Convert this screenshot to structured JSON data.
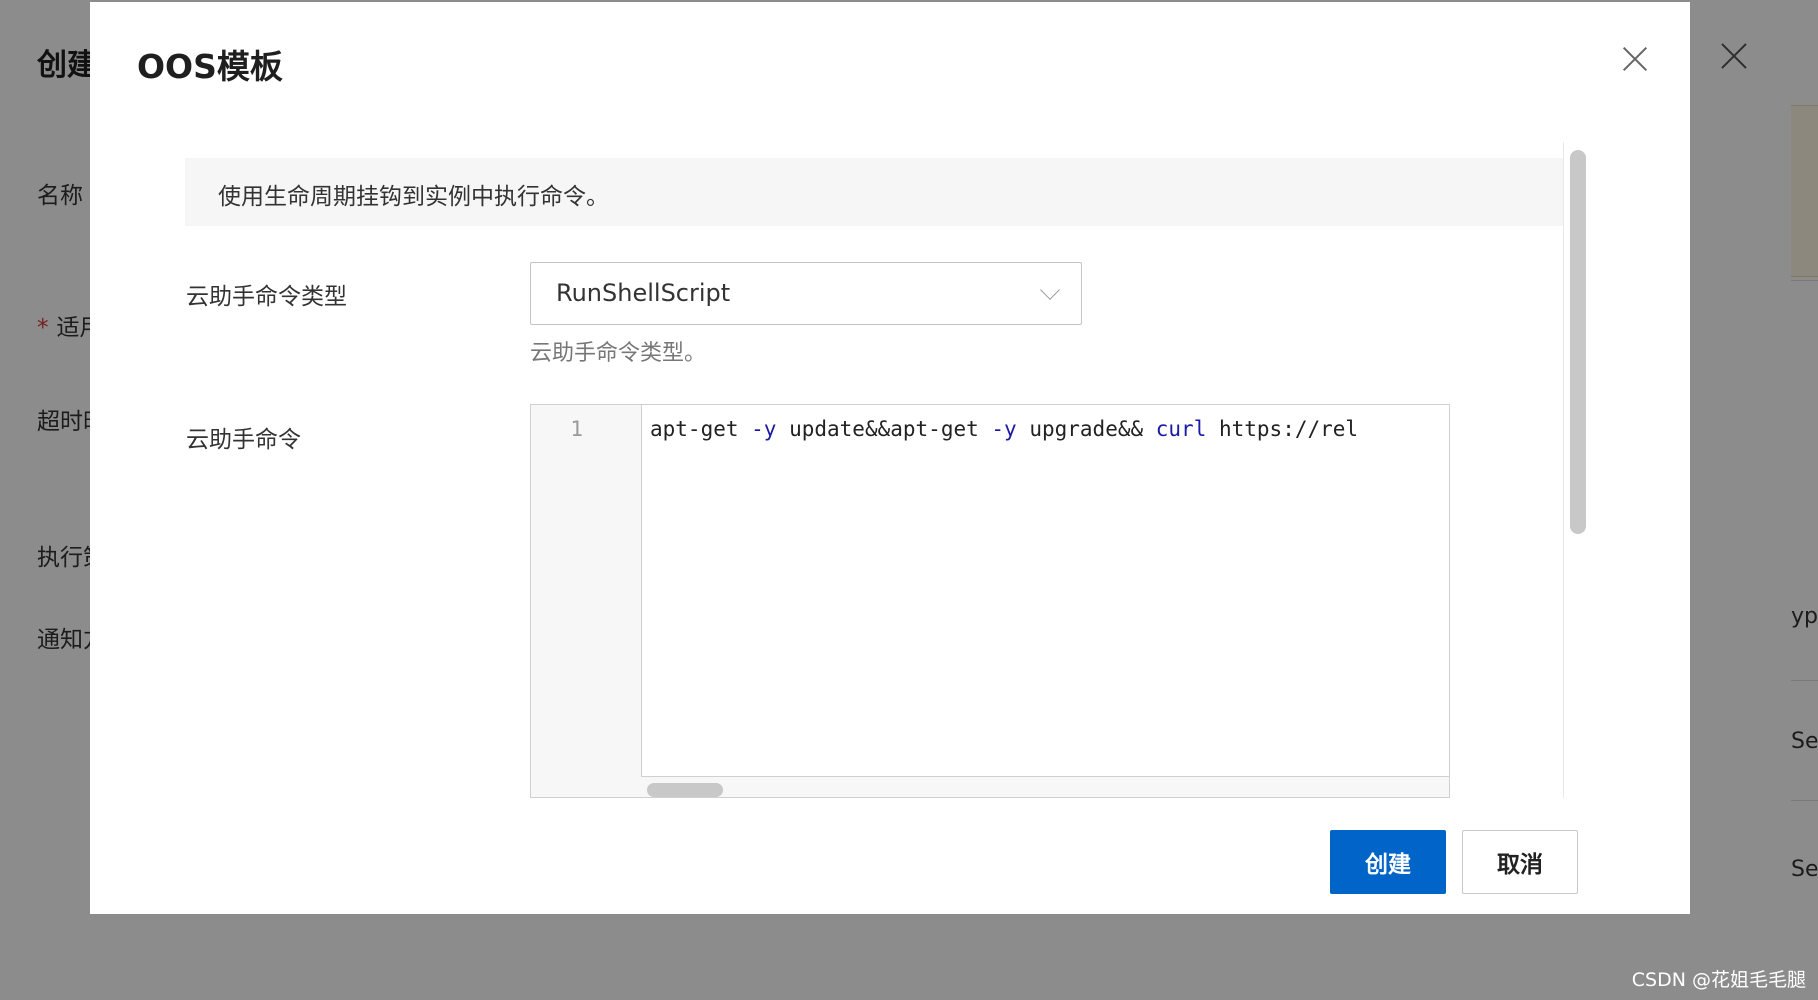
{
  "background": {
    "page_title": "创建",
    "labels": [
      {
        "text": "名称",
        "required": false
      },
      {
        "text": "适用",
        "required": true
      },
      {
        "text": "超时时",
        "required": false
      },
      {
        "text": "执行策",
        "required": false
      },
      {
        "text": "通知方",
        "required": false
      }
    ],
    "right_fragments": [
      "ype",
      "Ser",
      "Ser"
    ]
  },
  "modal": {
    "title": "OOS模板",
    "info_text": "使用生命周期挂钩到实例中执行命令。",
    "command_type": {
      "label": "云助手命令类型",
      "value": "RunShellScript",
      "help": "云助手命令类型。"
    },
    "command": {
      "label": "云助手命令",
      "line_number": "1",
      "code_parts": [
        {
          "text": "apt-get ",
          "kw": false
        },
        {
          "text": "-y",
          "kw": true
        },
        {
          "text": " update&&apt-get ",
          "kw": false
        },
        {
          "text": "-y",
          "kw": true
        },
        {
          "text": " upgrade&& ",
          "kw": false
        },
        {
          "text": "curl",
          "kw": true
        },
        {
          "text": " https://rel",
          "kw": false
        }
      ]
    },
    "buttons": {
      "create": "创建",
      "cancel": "取消"
    }
  },
  "watermark": "CSDN @花姐毛毛腿"
}
